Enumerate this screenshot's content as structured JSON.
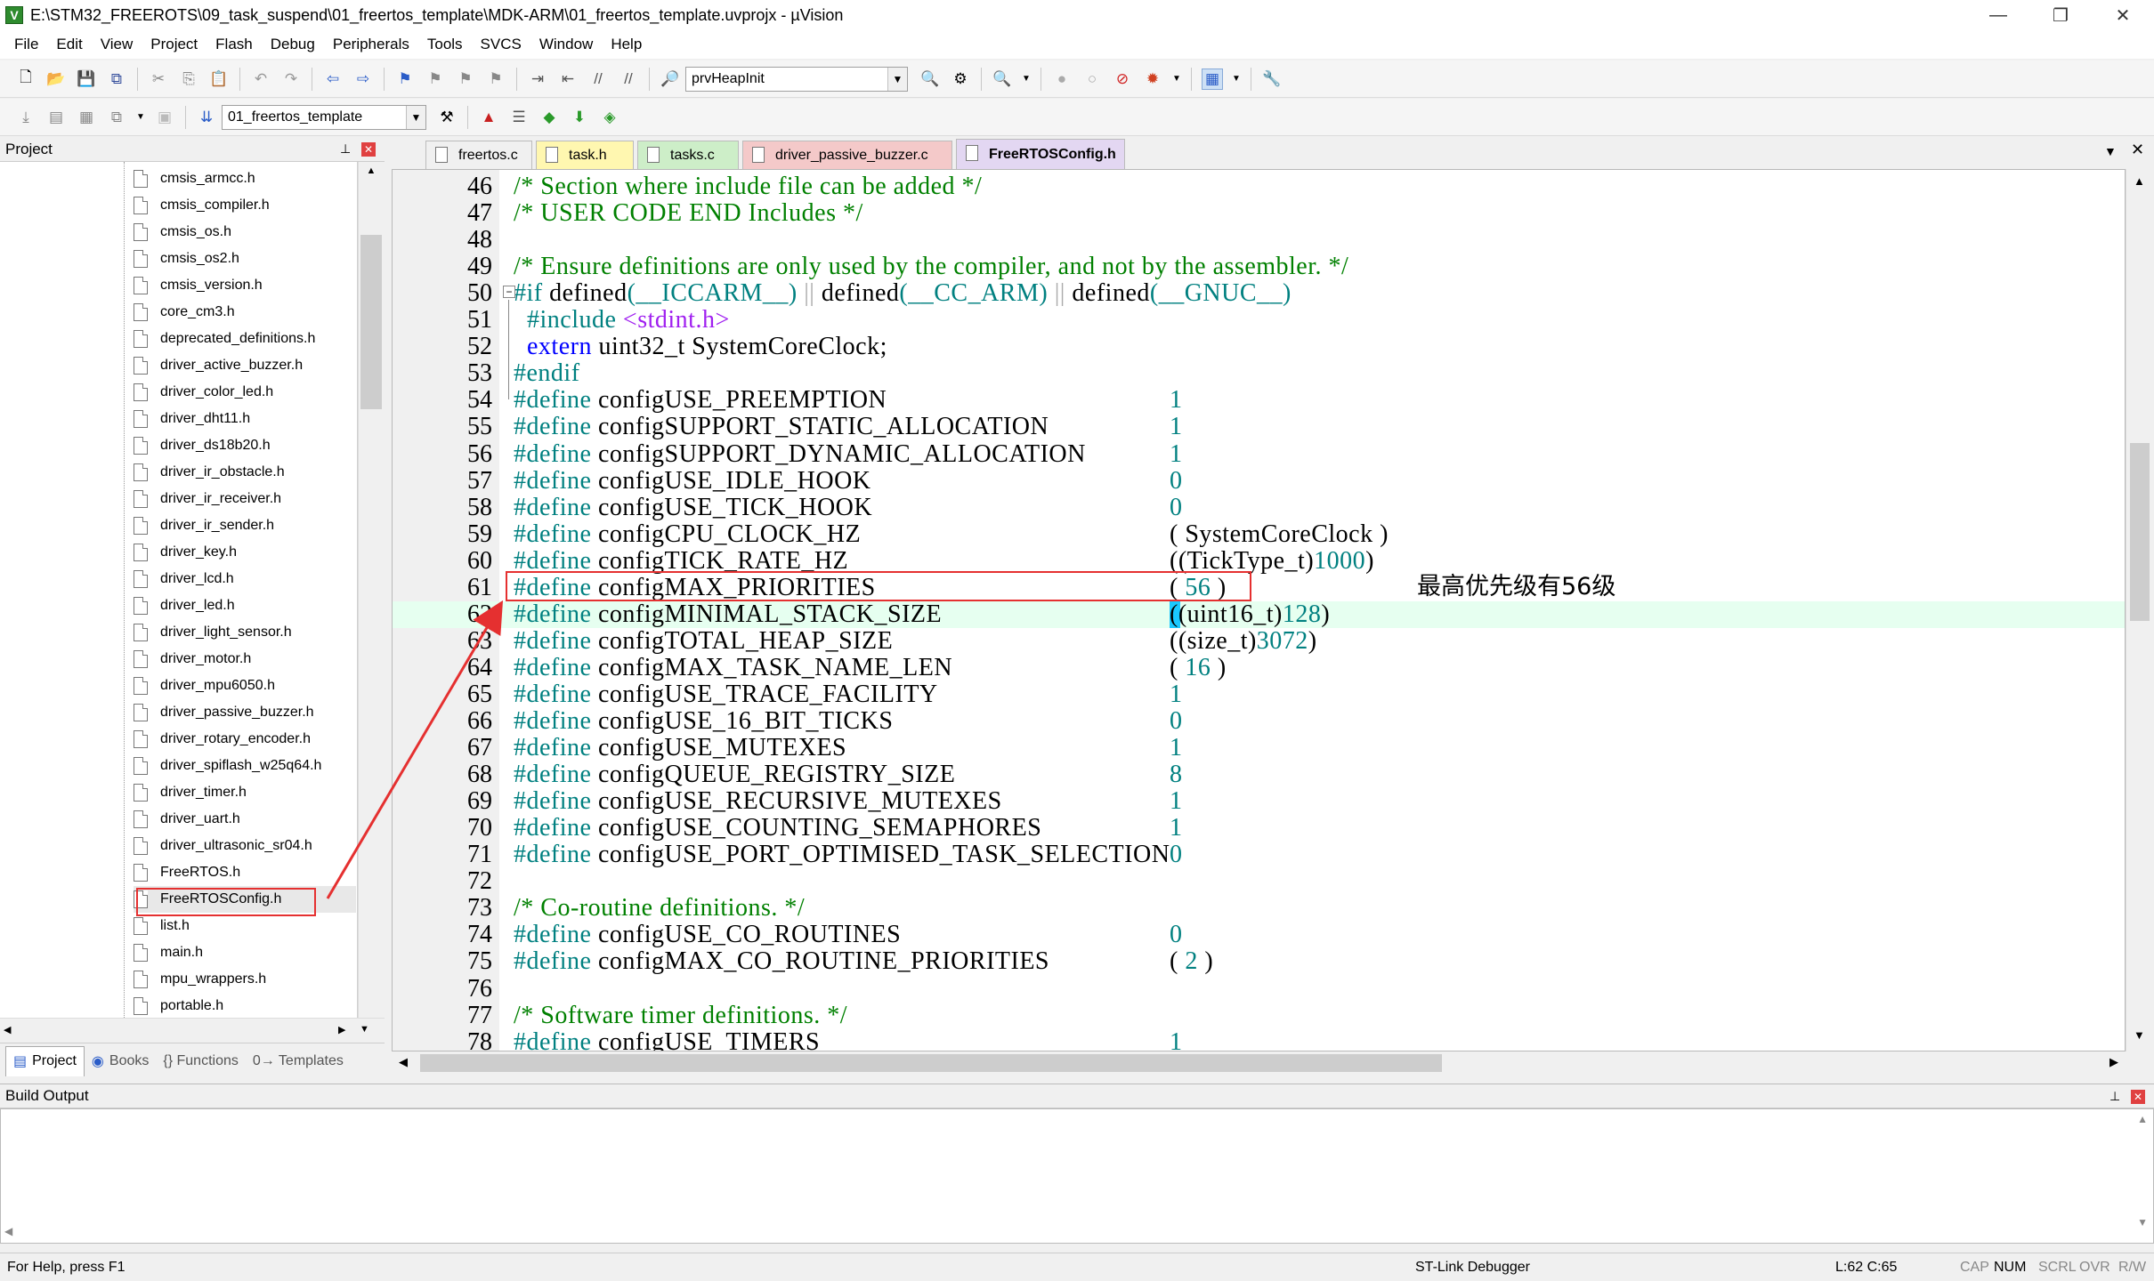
{
  "window": {
    "title": "E:\\STM32_FREEROTS\\09_task_suspend\\01_freertos_template\\MDK-ARM\\01_freertos_template.uvprojx - µVision",
    "app_icon": "V",
    "minimize": "—",
    "maximize": "❐",
    "close": "✕"
  },
  "menu": [
    "File",
    "Edit",
    "View",
    "Project",
    "Flash",
    "Debug",
    "Peripherals",
    "Tools",
    "SVCS",
    "Window",
    "Help"
  ],
  "toolbar1": {
    "function_combo": "prvHeapInit"
  },
  "toolbar2": {
    "target_combo": "01_freertos_template"
  },
  "project_panel": {
    "title": "Project",
    "pin": "⊥",
    "close": "✕",
    "files": [
      "cmsis_armcc.h",
      "cmsis_compiler.h",
      "cmsis_os.h",
      "cmsis_os2.h",
      "cmsis_version.h",
      "core_cm3.h",
      "deprecated_definitions.h",
      "driver_active_buzzer.h",
      "driver_color_led.h",
      "driver_dht11.h",
      "driver_ds18b20.h",
      "driver_ir_obstacle.h",
      "driver_ir_receiver.h",
      "driver_ir_sender.h",
      "driver_key.h",
      "driver_lcd.h",
      "driver_led.h",
      "driver_light_sensor.h",
      "driver_motor.h",
      "driver_mpu6050.h",
      "driver_passive_buzzer.h",
      "driver_rotary_encoder.h",
      "driver_spiflash_w25q64.h",
      "driver_timer.h",
      "driver_uart.h",
      "driver_ultrasonic_sr04.h",
      "FreeRTOS.h",
      "FreeRTOSConfig.h",
      "list.h",
      "main.h",
      "mpu_wrappers.h",
      "portable.h"
    ],
    "selected_file": "FreeRTOSConfig.h",
    "tabs": [
      "Project",
      "Books",
      "{} Functions",
      "0→ Templates"
    ]
  },
  "editor_tabs": [
    {
      "label": "freertos.c",
      "color": "#f0f0f0"
    },
    {
      "label": "task.h",
      "color": "#fff7b0"
    },
    {
      "label": "tasks.c",
      "color": "#cdeec8"
    },
    {
      "label": "driver_passive_buzzer.c",
      "color": "#f4c9c9"
    },
    {
      "label": "FreeRTOSConfig.h",
      "color": "#e3d7f2"
    }
  ],
  "active_editor_tab": "FreeRTOSConfig.h",
  "code": [
    {
      "n": "46",
      "t": "/* Section where include file can be added */",
      "k": "cmt"
    },
    {
      "n": "47",
      "t": "/* USER CODE END Includes */",
      "k": "cmt"
    },
    {
      "n": "48",
      "t": "",
      "k": "txt"
    },
    {
      "n": "49",
      "t": "/* Ensure definitions are only used by the compiler, and not by the assembler. */",
      "k": "cmt"
    },
    {
      "n": "50",
      "t": "#if defined(__ICCARM__) || defined(__CC_ARM) || defined(__GNUC__)",
      "k": "if"
    },
    {
      "n": "51",
      "t": "  #include <stdint.h>",
      "k": "inc"
    },
    {
      "n": "52",
      "t": "  extern uint32_t SystemCoreClock;",
      "k": "ext"
    },
    {
      "n": "53",
      "t": "#endif",
      "k": "pp"
    },
    {
      "n": "54",
      "t": "#define configUSE_PREEMPTION",
      "v": "1",
      "k": "def"
    },
    {
      "n": "55",
      "t": "#define configSUPPORT_STATIC_ALLOCATION",
      "v": "1",
      "k": "def"
    },
    {
      "n": "56",
      "t": "#define configSUPPORT_DYNAMIC_ALLOCATION",
      "v": "1",
      "k": "def"
    },
    {
      "n": "57",
      "t": "#define configUSE_IDLE_HOOK",
      "v": "0",
      "k": "def"
    },
    {
      "n": "58",
      "t": "#define configUSE_TICK_HOOK",
      "v": "0",
      "k": "def"
    },
    {
      "n": "59",
      "t": "#define configCPU_CLOCK_HZ",
      "v": "( SystemCoreClock )",
      "k": "def"
    },
    {
      "n": "60",
      "t": "#define configTICK_RATE_HZ",
      "v": "((TickType_t)1000)",
      "k": "def"
    },
    {
      "n": "61",
      "t": "#define configMAX_PRIORITIES",
      "v": "( 56 )",
      "k": "def"
    },
    {
      "n": "62",
      "t": "#define configMINIMAL_STACK_SIZE",
      "v": "((uint16_t)128)",
      "k": "def"
    },
    {
      "n": "63",
      "t": "#define configTOTAL_HEAP_SIZE",
      "v": "((size_t)3072)",
      "k": "def"
    },
    {
      "n": "64",
      "t": "#define configMAX_TASK_NAME_LEN",
      "v": "( 16 )",
      "k": "def"
    },
    {
      "n": "65",
      "t": "#define configUSE_TRACE_FACILITY",
      "v": "1",
      "k": "def"
    },
    {
      "n": "66",
      "t": "#define configUSE_16_BIT_TICKS",
      "v": "0",
      "k": "def"
    },
    {
      "n": "67",
      "t": "#define configUSE_MUTEXES",
      "v": "1",
      "k": "def"
    },
    {
      "n": "68",
      "t": "#define configQUEUE_REGISTRY_SIZE",
      "v": "8",
      "k": "def"
    },
    {
      "n": "69",
      "t": "#define configUSE_RECURSIVE_MUTEXES",
      "v": "1",
      "k": "def"
    },
    {
      "n": "70",
      "t": "#define configUSE_COUNTING_SEMAPHORES",
      "v": "1",
      "k": "def"
    },
    {
      "n": "71",
      "t": "#define configUSE_PORT_OPTIMISED_TASK_SELECTION",
      "v": "0",
      "k": "def"
    },
    {
      "n": "72",
      "t": "",
      "k": "txt"
    },
    {
      "n": "73",
      "t": "/* Co-routine definitions. */",
      "k": "cmt"
    },
    {
      "n": "74",
      "t": "#define configUSE_CO_ROUTINES",
      "v": "0",
      "k": "def"
    },
    {
      "n": "75",
      "t": "#define configMAX_CO_ROUTINE_PRIORITIES",
      "v": "( 2 )",
      "k": "def"
    },
    {
      "n": "76",
      "t": "",
      "k": "txt"
    },
    {
      "n": "77",
      "t": "/* Software timer definitions. */",
      "k": "cmt"
    },
    {
      "n": "78",
      "t": "#define configUSE_TIMERS",
      "v": "1",
      "k": "def"
    }
  ],
  "highlight_line": "62",
  "annotation": "最高优先级有56级",
  "annotation_color": "#e53030",
  "build_output": {
    "title": "Build Output",
    "content": ""
  },
  "status": {
    "help": "For Help, press F1",
    "debugger": "ST-Link Debugger",
    "position": "L:62 C:65",
    "cap": "CAP",
    "num": "NUM",
    "scrl": "SCRL",
    "ovr": "OVR",
    "rw": "R/W"
  }
}
